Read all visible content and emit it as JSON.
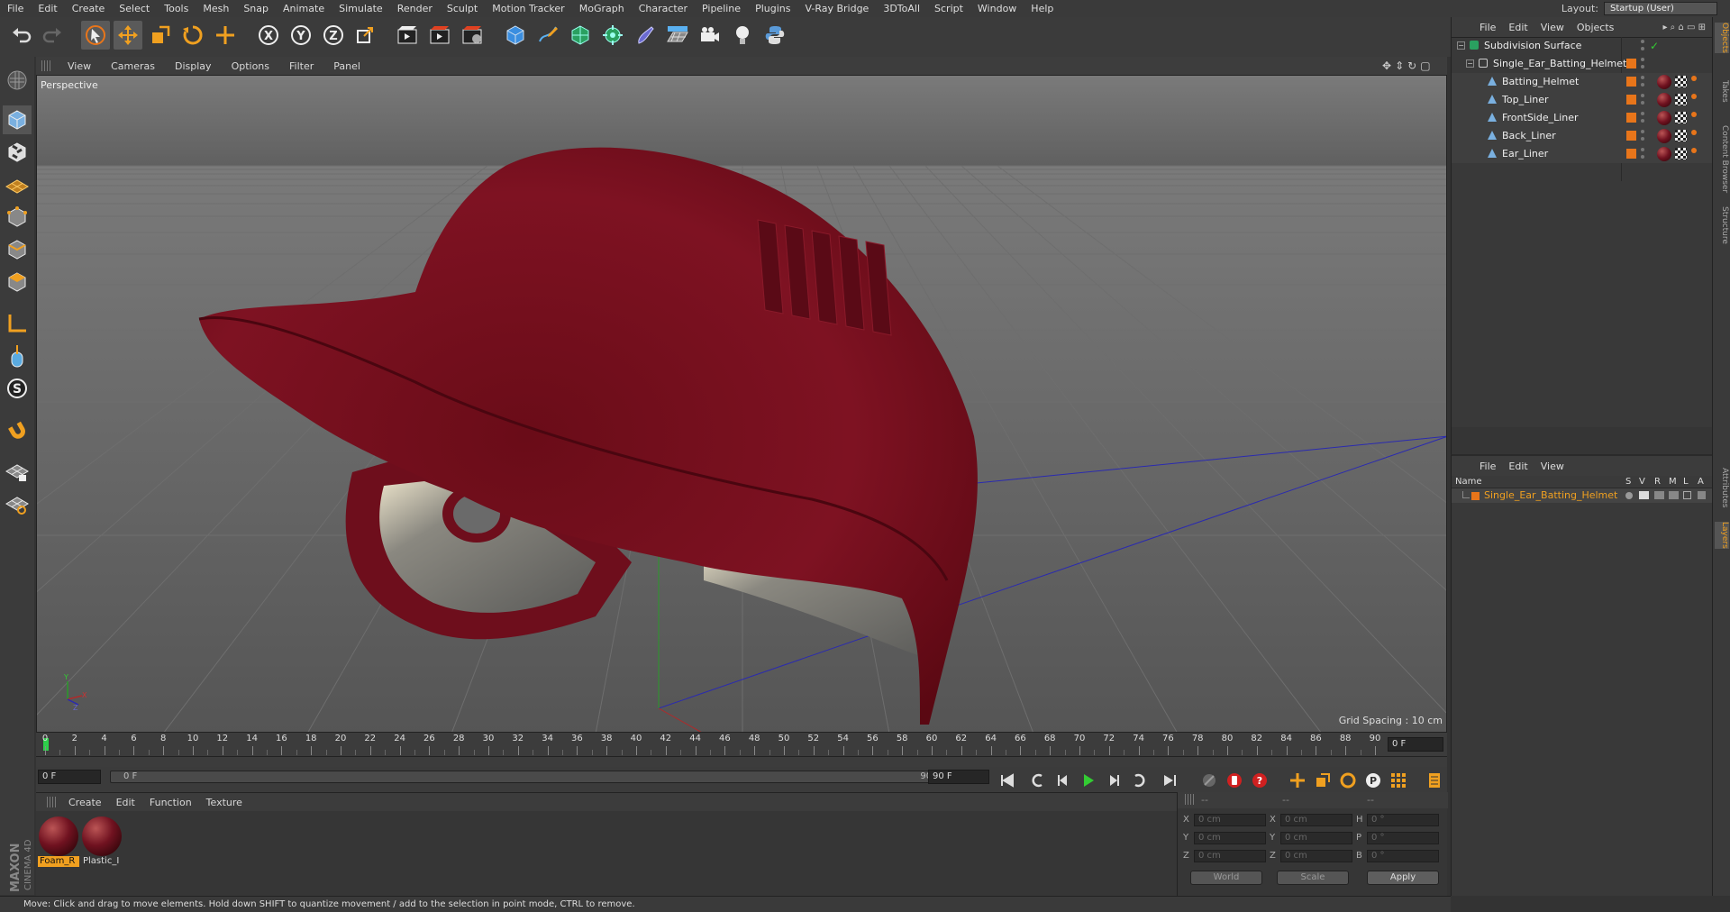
{
  "menu": [
    "File",
    "Edit",
    "Create",
    "Select",
    "Tools",
    "Mesh",
    "Snap",
    "Animate",
    "Simulate",
    "Render",
    "Sculpt",
    "Motion Tracker",
    "MoGraph",
    "Character",
    "Pipeline",
    "Plugins",
    "V-Ray Bridge",
    "3DToAll",
    "Script",
    "Window",
    "Help"
  ],
  "layout": {
    "label": "Layout:",
    "value": "Startup (User)"
  },
  "viewport": {
    "menu": [
      "View",
      "Cameras",
      "Display",
      "Options",
      "Filter",
      "Panel"
    ],
    "label": "Perspective",
    "grid_spacing": "Grid Spacing : 10 cm"
  },
  "timeline": {
    "ticks": [
      "0",
      "2",
      "4",
      "6",
      "8",
      "10",
      "12",
      "14",
      "16",
      "18",
      "20",
      "22",
      "24",
      "26",
      "28",
      "30",
      "32",
      "34",
      "36",
      "38",
      "40",
      "42",
      "44",
      "46",
      "48",
      "50",
      "52",
      "54",
      "56",
      "58",
      "60",
      "62",
      "64",
      "66",
      "68",
      "70",
      "72",
      "74",
      "76",
      "78",
      "80",
      "82",
      "84",
      "86",
      "88",
      "90"
    ],
    "frame_right": "0 F",
    "current_frame": "0 F",
    "range_start": "0 F",
    "range_end": "90 F",
    "end_frame": "90 F"
  },
  "materials": {
    "menu": [
      "Create",
      "Edit",
      "Function",
      "Texture"
    ],
    "items": [
      {
        "label": "Foam_R",
        "selected": true
      },
      {
        "label": "Plastic_I",
        "selected": false
      }
    ]
  },
  "coords": {
    "header": [
      "--",
      "--",
      "--"
    ],
    "rows": [
      {
        "l1": "X",
        "v1": "0 cm",
        "l2": "X",
        "v2": "0 cm",
        "l3": "H",
        "v3": "0 °"
      },
      {
        "l1": "Y",
        "v1": "0 cm",
        "l2": "Y",
        "v2": "0 cm",
        "l3": "P",
        "v3": "0 °"
      },
      {
        "l1": "Z",
        "v1": "0 cm",
        "l2": "Z",
        "v2": "0 cm",
        "l3": "B",
        "v3": "0 °"
      }
    ],
    "mode1": "World",
    "mode2": "Scale",
    "apply": "Apply"
  },
  "status": "Move: Click and drag to move elements. Hold down SHIFT to quantize movement / add to the selection in point mode, CTRL to remove.",
  "objects": {
    "menu": [
      "File",
      "Edit",
      "View",
      "Objects"
    ],
    "items": [
      {
        "name": "Subdivision Surface",
        "level": 0
      },
      {
        "name": "Single_Ear_Batting_Helmet",
        "level": 1
      },
      {
        "name": "Batting_Helmet",
        "level": 2
      },
      {
        "name": "Top_Liner",
        "level": 2
      },
      {
        "name": "FrontSide_Liner",
        "level": 2
      },
      {
        "name": "Back_Liner",
        "level": 2
      },
      {
        "name": "Ear_Liner",
        "level": 2
      }
    ]
  },
  "layers": {
    "menu": [
      "File",
      "Edit",
      "View"
    ],
    "columns": [
      "Name",
      "S",
      "V",
      "R",
      "M",
      "L",
      "A"
    ],
    "item": "Single_Ear_Batting_Helmet"
  },
  "sidetabs": [
    "Objects",
    "Takes",
    "Content Browser",
    "Structure",
    "Attributes",
    "Layers"
  ],
  "logo": {
    "line1": "MAXON",
    "line2": "CINEMA 4D"
  },
  "colors": {
    "helmet": "#7a1020",
    "accent": "#e8751a",
    "bg": "#333333"
  }
}
